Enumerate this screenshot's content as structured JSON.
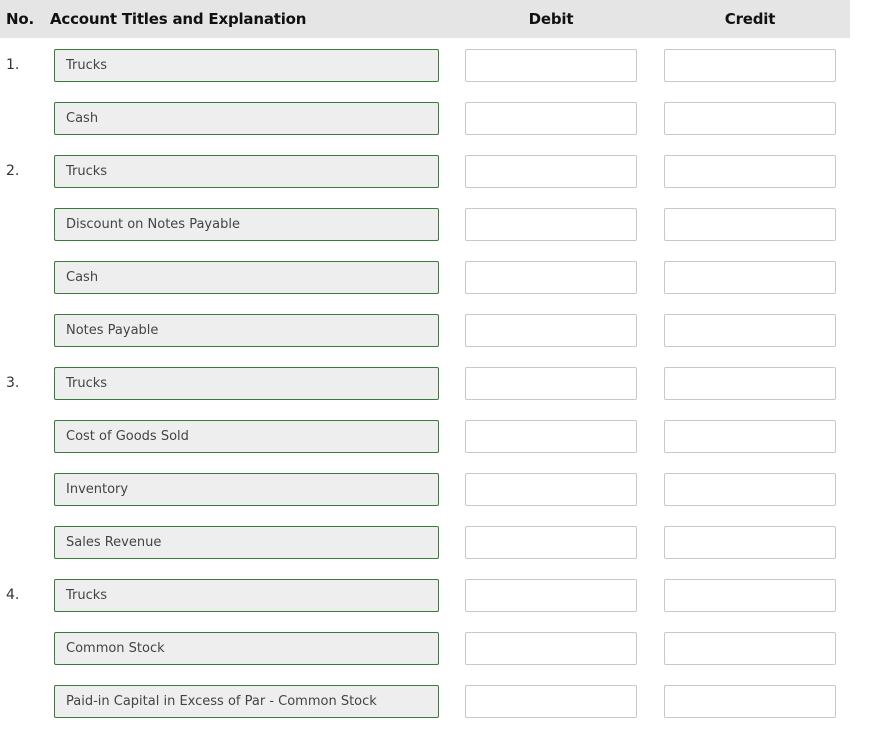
{
  "header": {
    "no": "No.",
    "account": "Account Titles and Explanation",
    "debit": "Debit",
    "credit": "Credit"
  },
  "rows": [
    {
      "no": "1.",
      "account": "Trucks",
      "debit": "",
      "credit": ""
    },
    {
      "no": "",
      "account": "Cash",
      "debit": "",
      "credit": ""
    },
    {
      "no": "2.",
      "account": "Trucks",
      "debit": "",
      "credit": ""
    },
    {
      "no": "",
      "account": "Discount on Notes Payable",
      "debit": "",
      "credit": ""
    },
    {
      "no": "",
      "account": "Cash",
      "debit": "",
      "credit": ""
    },
    {
      "no": "",
      "account": "Notes Payable",
      "debit": "",
      "credit": ""
    },
    {
      "no": "3.",
      "account": "Trucks",
      "debit": "",
      "credit": ""
    },
    {
      "no": "",
      "account": "Cost of Goods Sold",
      "debit": "",
      "credit": ""
    },
    {
      "no": "",
      "account": "Inventory",
      "debit": "",
      "credit": ""
    },
    {
      "no": "",
      "account": "Sales Revenue",
      "debit": "",
      "credit": ""
    },
    {
      "no": "4.",
      "account": "Trucks",
      "debit": "",
      "credit": ""
    },
    {
      "no": "",
      "account": "Common Stock",
      "debit": "",
      "credit": ""
    },
    {
      "no": "",
      "account": "Paid-in Capital in Excess of Par - Common Stock",
      "debit": "",
      "credit": ""
    }
  ]
}
